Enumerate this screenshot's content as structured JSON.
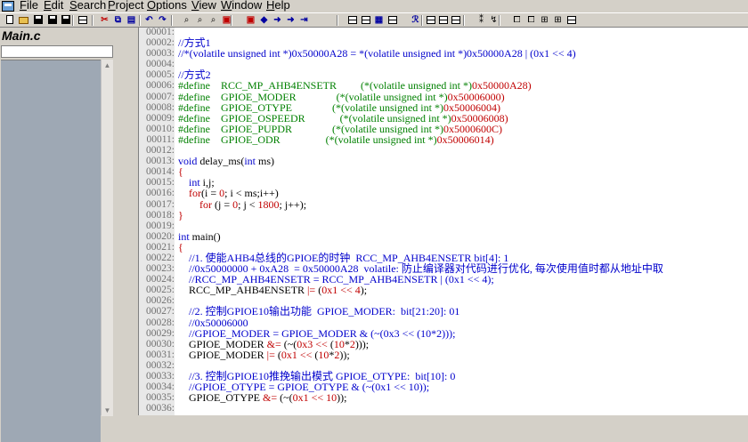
{
  "menu": [
    {
      "label": "File",
      "ul": "F",
      "rest": "ile"
    },
    {
      "label": "Edit",
      "ul": "E",
      "rest": "dit"
    },
    {
      "label": "Search",
      "ul": "S",
      "rest": "earch"
    },
    {
      "label": "Project",
      "ul": "P",
      "rest": "roject"
    },
    {
      "label": "Options",
      "ul": "O",
      "rest": "ptions"
    },
    {
      "label": "View",
      "ul": "V",
      "rest": "iew"
    },
    {
      "label": "Window",
      "ul": "W",
      "rest": "indow"
    },
    {
      "label": "Help",
      "ul": "H",
      "rest": "elp"
    }
  ],
  "sidebar": {
    "title": "Main.c",
    "input_value": ""
  },
  "toolbar_icons": [
    "new-file-icon",
    "open-file-icon",
    "save-icon",
    "save-all-icon",
    "close-icon",
    "print-icon",
    "cut-icon",
    "copy-icon",
    "paste-icon",
    "undo-icon",
    "redo-icon",
    "find-icon",
    "find-next-icon",
    "find-files-icon",
    "bookmark-icon",
    "bookmark-next-icon",
    "back-icon",
    "forward-icon",
    "jump-icon",
    "symbol-window-icon",
    "relation-window-icon",
    "project-window-icon",
    "book-icon",
    "context-icon",
    "layout-1-icon",
    "layout-2-icon",
    "layout-3-icon",
    "layout-4-icon",
    "sync-icon",
    "tip-icon",
    "browse-icon",
    "graph-icon",
    "outline-icon",
    "table-icon"
  ],
  "code_lines": [
    {
      "n": "00001:",
      "t": []
    },
    {
      "n": "00002:",
      "t": [
        {
          "c": "c-cmt",
          "s": "//方式1"
        }
      ]
    },
    {
      "n": "00003:",
      "t": [
        {
          "c": "c-cmt",
          "s": "//*(volatile unsigned int *)0x50000A28 = *(volatile unsigned int *)0x50000A28 | (0x1 << 4)"
        }
      ]
    },
    {
      "n": "00004:",
      "t": []
    },
    {
      "n": "00005:",
      "t": [
        {
          "c": "c-cmt",
          "s": "//方式2"
        }
      ]
    },
    {
      "n": "00006:",
      "t": [
        {
          "c": "c-green",
          "s": "#define    RCC_MP_AHB4ENSETR         "
        },
        {
          "c": "c-green",
          "s": "(*(volatile unsigned int *)"
        },
        {
          "c": "c-red",
          "s": "0x50000A28)"
        }
      ]
    },
    {
      "n": "00007:",
      "t": [
        {
          "c": "c-green",
          "s": "#define    GPIOE_MODER               "
        },
        {
          "c": "c-green",
          "s": "(*(volatile unsigned int *)"
        },
        {
          "c": "c-red",
          "s": "0x50006000)"
        }
      ]
    },
    {
      "n": "00008:",
      "t": [
        {
          "c": "c-green",
          "s": "#define    GPIOE_OTYPE               "
        },
        {
          "c": "c-green",
          "s": "(*(volatile unsigned int *)"
        },
        {
          "c": "c-red",
          "s": "0x50006004)"
        }
      ]
    },
    {
      "n": "00009:",
      "t": [
        {
          "c": "c-green",
          "s": "#define    GPIOE_OSPEEDR             "
        },
        {
          "c": "c-green",
          "s": "(*(volatile unsigned int *)"
        },
        {
          "c": "c-red",
          "s": "0x50006008)"
        }
      ]
    },
    {
      "n": "00010:",
      "t": [
        {
          "c": "c-green",
          "s": "#define    GPIOE_PUPDR               "
        },
        {
          "c": "c-green",
          "s": "(*(volatile unsigned int *)"
        },
        {
          "c": "c-red",
          "s": "0x5000600C)"
        }
      ]
    },
    {
      "n": "00011:",
      "t": [
        {
          "c": "c-green",
          "s": "#define    GPIOE_ODR                 "
        },
        {
          "c": "c-green",
          "s": "(*(volatile unsigned int *)"
        },
        {
          "c": "c-red",
          "s": "0x50006014)"
        }
      ]
    },
    {
      "n": "00012:",
      "t": []
    },
    {
      "n": "00013:",
      "t": [
        {
          "c": "c-kw",
          "s": "void "
        },
        {
          "c": "c-bl",
          "s": "delay_ms("
        },
        {
          "c": "c-kw",
          "s": "int "
        },
        {
          "c": "c-bl",
          "s": "ms)"
        }
      ]
    },
    {
      "n": "00014:",
      "t": [
        {
          "c": "c-red",
          "s": "{"
        }
      ]
    },
    {
      "n": "00015:",
      "t": [
        {
          "c": "c-bl",
          "s": "    "
        },
        {
          "c": "c-kw",
          "s": "int "
        },
        {
          "c": "c-bl",
          "s": "i,j;"
        }
      ]
    },
    {
      "n": "00016:",
      "t": [
        {
          "c": "c-bl",
          "s": "    "
        },
        {
          "c": "c-red",
          "s": "for"
        },
        {
          "c": "c-bl",
          "s": "(i = "
        },
        {
          "c": "c-red",
          "s": "0"
        },
        {
          "c": "c-bl",
          "s": "; i < ms;i++)"
        }
      ]
    },
    {
      "n": "00017:",
      "t": [
        {
          "c": "c-bl",
          "s": "        "
        },
        {
          "c": "c-red",
          "s": "for "
        },
        {
          "c": "c-bl",
          "s": "(j = "
        },
        {
          "c": "c-red",
          "s": "0"
        },
        {
          "c": "c-bl",
          "s": "; j < "
        },
        {
          "c": "c-red",
          "s": "1800"
        },
        {
          "c": "c-bl",
          "s": "; j++);"
        }
      ]
    },
    {
      "n": "00018:",
      "t": [
        {
          "c": "c-red",
          "s": "}"
        }
      ]
    },
    {
      "n": "00019:",
      "t": []
    },
    {
      "n": "00020:",
      "t": [
        {
          "c": "c-kw",
          "s": "int "
        },
        {
          "c": "c-bl",
          "s": "main()"
        }
      ]
    },
    {
      "n": "00021:",
      "t": [
        {
          "c": "c-red",
          "s": "{"
        }
      ]
    },
    {
      "n": "00022:",
      "t": [
        {
          "c": "c-bl",
          "s": "    "
        },
        {
          "c": "c-cmt",
          "s": "//1. 使能AHB4总线的GPIOE的时钟  RCC_MP_AHB4ENSETR bit[4]: 1"
        }
      ]
    },
    {
      "n": "00023:",
      "t": [
        {
          "c": "c-bl",
          "s": "    "
        },
        {
          "c": "c-cmt",
          "s": "//0x50000000 + 0xA28  = 0x50000A28  volatile: 防止编译器对代码进行优化, 每次使用值时都从地址中取"
        }
      ]
    },
    {
      "n": "00024:",
      "t": [
        {
          "c": "c-bl",
          "s": "    "
        },
        {
          "c": "c-cmt",
          "s": "//RCC_MP_AHB4ENSETR = RCC_MP_AHB4ENSETR | (0x1 << 4);"
        }
      ]
    },
    {
      "n": "00025:",
      "t": [
        {
          "c": "c-bl",
          "s": "    RCC_MP_AHB4ENSETR "
        },
        {
          "c": "c-red",
          "s": "|= "
        },
        {
          "c": "c-bl",
          "s": "("
        },
        {
          "c": "c-red",
          "s": "0x1 << 4"
        },
        {
          "c": "c-bl",
          "s": ");"
        }
      ]
    },
    {
      "n": "00026:",
      "t": []
    },
    {
      "n": "00027:",
      "t": [
        {
          "c": "c-bl",
          "s": "    "
        },
        {
          "c": "c-cmt",
          "s": "//2. 控制GPIOE10输出功能  GPIOE_MODER:  bit[21:20]: 01"
        }
      ]
    },
    {
      "n": "00028:",
      "t": [
        {
          "c": "c-bl",
          "s": "    "
        },
        {
          "c": "c-cmt",
          "s": "//0x50006000"
        }
      ]
    },
    {
      "n": "00029:",
      "t": [
        {
          "c": "c-bl",
          "s": "    "
        },
        {
          "c": "c-cmt",
          "s": "//GPIOE_MODER = GPIOE_MODER & (~(0x3 << (10*2)));"
        }
      ]
    },
    {
      "n": "00030:",
      "t": [
        {
          "c": "c-bl",
          "s": "    GPIOE_MODER "
        },
        {
          "c": "c-red",
          "s": "&= "
        },
        {
          "c": "c-bl",
          "s": "(~("
        },
        {
          "c": "c-red",
          "s": "0x3 << "
        },
        {
          "c": "c-bl",
          "s": "("
        },
        {
          "c": "c-red",
          "s": "10"
        },
        {
          "c": "c-bl",
          "s": "*"
        },
        {
          "c": "c-red",
          "s": "2"
        },
        {
          "c": "c-bl",
          "s": ")));"
        }
      ]
    },
    {
      "n": "00031:",
      "t": [
        {
          "c": "c-bl",
          "s": "    GPIOE_MODER "
        },
        {
          "c": "c-red",
          "s": "|= "
        },
        {
          "c": "c-bl",
          "s": "("
        },
        {
          "c": "c-red",
          "s": "0x1 << "
        },
        {
          "c": "c-bl",
          "s": "("
        },
        {
          "c": "c-red",
          "s": "10"
        },
        {
          "c": "c-bl",
          "s": "*"
        },
        {
          "c": "c-red",
          "s": "2"
        },
        {
          "c": "c-bl",
          "s": "));"
        }
      ]
    },
    {
      "n": "00032:",
      "t": []
    },
    {
      "n": "00033:",
      "t": [
        {
          "c": "c-bl",
          "s": "    "
        },
        {
          "c": "c-cmt",
          "s": "//3. 控制GPIOE10推挽输出模式 GPIOE_OTYPE:  bit[10]: 0"
        }
      ]
    },
    {
      "n": "00034:",
      "t": [
        {
          "c": "c-bl",
          "s": "    "
        },
        {
          "c": "c-cmt",
          "s": "//GPIOE_OTYPE = GPIOE_OTYPE & (~(0x1 << 10));"
        }
      ]
    },
    {
      "n": "00035:",
      "t": [
        {
          "c": "c-bl",
          "s": "    GPIOE_OTYPE "
        },
        {
          "c": "c-red",
          "s": "&= "
        },
        {
          "c": "c-bl",
          "s": "(~("
        },
        {
          "c": "c-red",
          "s": "0x1 << 10"
        },
        {
          "c": "c-bl",
          "s": "));"
        }
      ]
    },
    {
      "n": "00036:",
      "t": []
    }
  ]
}
